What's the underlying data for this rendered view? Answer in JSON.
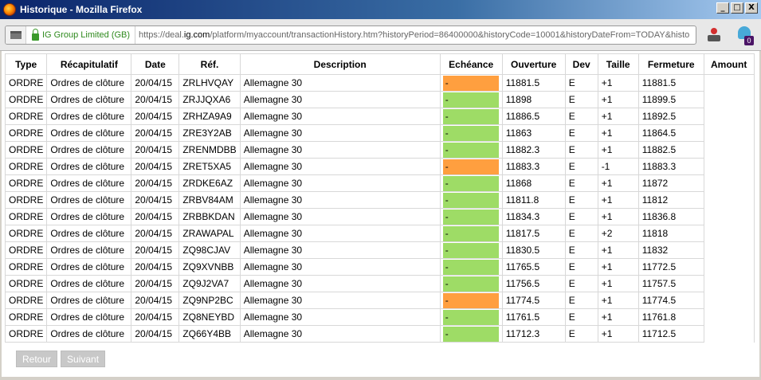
{
  "window": {
    "title": "Historique - Mozilla Firefox",
    "min": "_",
    "max": "□",
    "close": "X"
  },
  "address": {
    "identity": "IG Group Limited (GB)",
    "url_prefix": "https://deal.",
    "url_domain": "ig.com",
    "url_rest": "/platform/myaccount/transactionHistory.htm?historyPeriod=86400000&historyCode=10001&historyDateFrom=TODAY&histo",
    "badge_count": "0"
  },
  "table": {
    "headers": [
      "Type",
      "Récapitulatif",
      "Date",
      "Réf.",
      "Description",
      "Echéance",
      "Ouverture",
      "Dev",
      "Taille",
      "Fermeture",
      "Amount"
    ],
    "rows": [
      {
        "type": "ORDRE",
        "recap": "Ordres de clôture",
        "date": "20/04/15",
        "ref": "ZRLHVQAY",
        "desc": "Allemagne 30",
        "ech": "-",
        "status": "orange",
        "ouv": "11881.5",
        "dev": "E",
        "taille": "+1",
        "ferm": "11881.5"
      },
      {
        "type": "ORDRE",
        "recap": "Ordres de clôture",
        "date": "20/04/15",
        "ref": "ZRJJQXA6",
        "desc": "Allemagne 30",
        "ech": "-",
        "status": "green",
        "ouv": "11898",
        "dev": "E",
        "taille": "+1",
        "ferm": "11899.5"
      },
      {
        "type": "ORDRE",
        "recap": "Ordres de clôture",
        "date": "20/04/15",
        "ref": "ZRHZA9A9",
        "desc": "Allemagne 30",
        "ech": "-",
        "status": "green",
        "ouv": "11886.5",
        "dev": "E",
        "taille": "+1",
        "ferm": "11892.5"
      },
      {
        "type": "ORDRE",
        "recap": "Ordres de clôture",
        "date": "20/04/15",
        "ref": "ZRE3Y2AB",
        "desc": "Allemagne 30",
        "ech": "-",
        "status": "green",
        "ouv": "11863",
        "dev": "E",
        "taille": "+1",
        "ferm": "11864.5"
      },
      {
        "type": "ORDRE",
        "recap": "Ordres de clôture",
        "date": "20/04/15",
        "ref": "ZRENMDBB",
        "desc": "Allemagne 30",
        "ech": "-",
        "status": "green",
        "ouv": "11882.3",
        "dev": "E",
        "taille": "+1",
        "ferm": "11882.5"
      },
      {
        "type": "ORDRE",
        "recap": "Ordres de clôture",
        "date": "20/04/15",
        "ref": "ZRET5XA5",
        "desc": "Allemagne 30",
        "ech": "-",
        "status": "orange",
        "ouv": "11883.3",
        "dev": "E",
        "taille": "-1",
        "ferm": "11883.3"
      },
      {
        "type": "ORDRE",
        "recap": "Ordres de clôture",
        "date": "20/04/15",
        "ref": "ZRDKE6AZ",
        "desc": "Allemagne 30",
        "ech": "-",
        "status": "green",
        "ouv": "11868",
        "dev": "E",
        "taille": "+1",
        "ferm": "11872"
      },
      {
        "type": "ORDRE",
        "recap": "Ordres de clôture",
        "date": "20/04/15",
        "ref": "ZRBV84AM",
        "desc": "Allemagne 30",
        "ech": "-",
        "status": "green",
        "ouv": "11811.8",
        "dev": "E",
        "taille": "+1",
        "ferm": "11812"
      },
      {
        "type": "ORDRE",
        "recap": "Ordres de clôture",
        "date": "20/04/15",
        "ref": "ZRBBKDAN",
        "desc": "Allemagne 30",
        "ech": "-",
        "status": "green",
        "ouv": "11834.3",
        "dev": "E",
        "taille": "+1",
        "ferm": "11836.8"
      },
      {
        "type": "ORDRE",
        "recap": "Ordres de clôture",
        "date": "20/04/15",
        "ref": "ZRAWAPAL",
        "desc": "Allemagne 30",
        "ech": "-",
        "status": "green",
        "ouv": "11817.5",
        "dev": "E",
        "taille": "+2",
        "ferm": "11818"
      },
      {
        "type": "ORDRE",
        "recap": "Ordres de clôture",
        "date": "20/04/15",
        "ref": "ZQ98CJAV",
        "desc": "Allemagne 30",
        "ech": "-",
        "status": "green",
        "ouv": "11830.5",
        "dev": "E",
        "taille": "+1",
        "ferm": "11832"
      },
      {
        "type": "ORDRE",
        "recap": "Ordres de clôture",
        "date": "20/04/15",
        "ref": "ZQ9XVNBB",
        "desc": "Allemagne 30",
        "ech": "-",
        "status": "green",
        "ouv": "11765.5",
        "dev": "E",
        "taille": "+1",
        "ferm": "11772.5"
      },
      {
        "type": "ORDRE",
        "recap": "Ordres de clôture",
        "date": "20/04/15",
        "ref": "ZQ9J2VA7",
        "desc": "Allemagne 30",
        "ech": "-",
        "status": "green",
        "ouv": "11756.5",
        "dev": "E",
        "taille": "+1",
        "ferm": "11757.5"
      },
      {
        "type": "ORDRE",
        "recap": "Ordres de clôture",
        "date": "20/04/15",
        "ref": "ZQ9NP2BC",
        "desc": "Allemagne 30",
        "ech": "-",
        "status": "orange",
        "ouv": "11774.5",
        "dev": "E",
        "taille": "+1",
        "ferm": "11774.5"
      },
      {
        "type": "ORDRE",
        "recap": "Ordres de clôture",
        "date": "20/04/15",
        "ref": "ZQ8NEYBD",
        "desc": "Allemagne 30",
        "ech": "-",
        "status": "green",
        "ouv": "11761.5",
        "dev": "E",
        "taille": "+1",
        "ferm": "11761.8"
      },
      {
        "type": "ORDRE",
        "recap": "Ordres de clôture",
        "date": "20/04/15",
        "ref": "ZQ66Y4BB",
        "desc": "Allemagne 30",
        "ech": "-",
        "status": "green",
        "ouv": "11712.3",
        "dev": "E",
        "taille": "+1",
        "ferm": "11712.5"
      }
    ]
  },
  "pager": {
    "prev": "Retour",
    "next": "Suivant"
  },
  "colors": {
    "green": "#9edc66",
    "orange": "#ff9f3f"
  }
}
